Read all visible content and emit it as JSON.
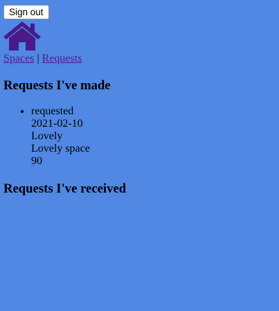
{
  "header": {
    "signout_label": "Sign out",
    "home_icon": "house-icon",
    "home_icon_color": "#4a1a8a"
  },
  "nav": {
    "spaces_label": "Spaces",
    "separator": "|",
    "requests_label": "Requests",
    "link_color": "#551a8b"
  },
  "made_section": {
    "heading": "Requests I've made",
    "requests": [
      {
        "status": "requested",
        "date": "2021-02-10",
        "space_name": "Lovely",
        "space_description": "Lovely space",
        "price": "90"
      }
    ]
  },
  "received_section": {
    "heading": "Requests I've received",
    "requests": []
  },
  "colors": {
    "background": "#5088e3"
  }
}
